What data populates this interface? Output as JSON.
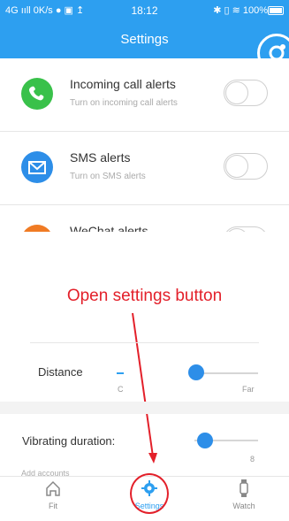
{
  "statusbar": {
    "left": "4G ııll 0K/s ● ▣ ↥",
    "time": "18:12",
    "right": "✱ ▯ ≋ 100%"
  },
  "header": {
    "title": "Settings"
  },
  "alerts": [
    {
      "title": "Incoming call alerts",
      "subtitle": "Turn on incoming call alerts",
      "icon": "phone-icon",
      "color": "#39c14a",
      "enabled": false
    },
    {
      "title": "SMS alerts",
      "subtitle": "Turn on SMS alerts",
      "icon": "mail-icon",
      "color": "#2d8ee8",
      "enabled": false
    },
    {
      "title": "WeChat alerts",
      "subtitle": "",
      "icon": "wechat-icon",
      "color": "#f07b24",
      "enabled": false
    }
  ],
  "annotation": {
    "text": "Open settings button",
    "color": "#e3202a"
  },
  "distance": {
    "label": "Distance",
    "min_label": "C",
    "max_label": "Far",
    "value": 0.42
  },
  "vibrating": {
    "label": "Vibrating duration:",
    "value_label": "8",
    "value": 0.2
  },
  "add_accounts": {
    "label": "Add accounts"
  },
  "tabs": [
    {
      "label": "Fit",
      "icon": "home-icon",
      "active": false
    },
    {
      "label": "Settings",
      "icon": "gear-icon",
      "active": true
    },
    {
      "label": "Watch",
      "icon": "watch-icon",
      "active": false
    }
  ],
  "colors": {
    "accent": "#2d9ff0",
    "annotation": "#e3202a"
  }
}
